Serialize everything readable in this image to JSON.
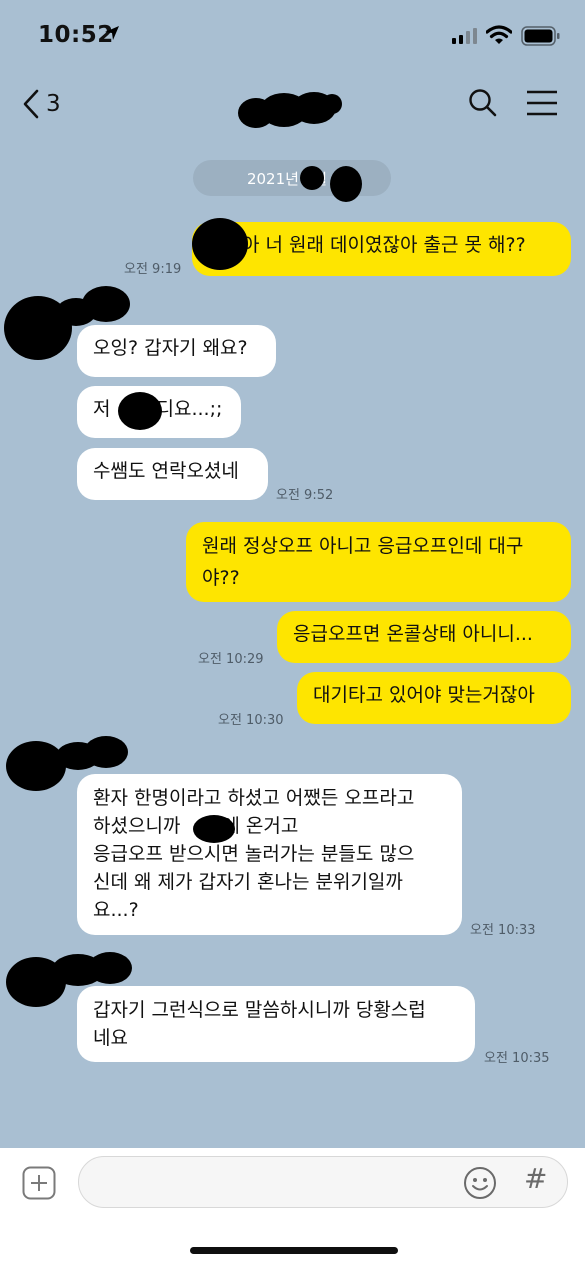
{
  "status_bar": {
    "time": "10:52"
  },
  "nav": {
    "back_count": "3"
  },
  "date_divider": "2021년 5월",
  "messages": [
    {
      "id": "m1",
      "side": "me",
      "text": "아 너 원래 데이였잖아 출근 못 해??",
      "time": "오전 9:19"
    },
    {
      "id": "m2",
      "side": "them",
      "text": "오잉? 갑자기 왜요?"
    },
    {
      "id": "m3",
      "side": "them",
      "text_before": "저",
      "text_after": "디요...;;"
    },
    {
      "id": "m4",
      "side": "them",
      "text": "수쌤도 연락오셨네",
      "time": "오전 9:52"
    },
    {
      "id": "m5",
      "side": "me",
      "lines": [
        "원래 정상오프 아니고 응급오프인데 대구",
        "야??"
      ]
    },
    {
      "id": "m6",
      "side": "me",
      "text": "응급오프면 온콜상태 아니니...",
      "time": "오전 10:29"
    },
    {
      "id": "m7",
      "side": "me",
      "text": "대기타고 있어야 맞는거잖아",
      "time": "오전 10:30"
    },
    {
      "id": "m8",
      "side": "them",
      "line1": "환자 한명이라고 하셨고 어쨌든 오프라고",
      "line2_before": "하셨으니까",
      "line2_after": "에 온거고",
      "line3": "응급오프 받으시면 놀러가는 분들도 많으",
      "line4": "신데 왜 제가 갑자기 혼나는 분위기일까",
      "line5": "요...?",
      "time": "오전 10:33"
    },
    {
      "id": "m9",
      "side": "them",
      "lines": [
        "갑자기 그런식으로 말씀하시니까 당황스럽",
        "네요"
      ],
      "time": "오전 10:35"
    }
  ],
  "icons": {
    "back": "chevron-left-icon",
    "search": "search-icon",
    "menu": "hamburger-menu-icon",
    "add": "plus-square-icon",
    "emoji": "emoji-icon",
    "hash": "hash-icon"
  },
  "input": {
    "hash_symbol": "#"
  },
  "colors": {
    "background": "#a9bfd2",
    "my_bubble": "#fee500",
    "their_bubble": "#ffffff"
  }
}
